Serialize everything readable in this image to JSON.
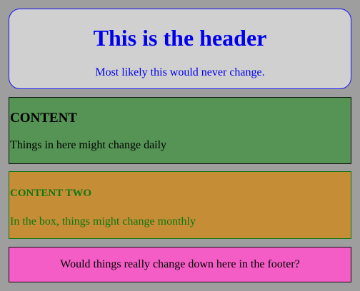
{
  "header": {
    "title": "This is the header",
    "subtitle": "Most likely this would never change."
  },
  "content": {
    "heading": "CONTENT",
    "text": "Things in here might change daily"
  },
  "content_two": {
    "heading": "CONTENT TWO",
    "text": "In the box, things might change monthly"
  },
  "footer": {
    "text": "Would things really change down here in the footer?"
  },
  "colors": {
    "page_background": "#9e9e9e",
    "header_background": "#d0d0d0",
    "header_text": "#0000ee",
    "content_background": "#559455",
    "content_two_background": "#c48d36",
    "content_two_text": "#117711",
    "footer_background": "#f45dc5"
  }
}
